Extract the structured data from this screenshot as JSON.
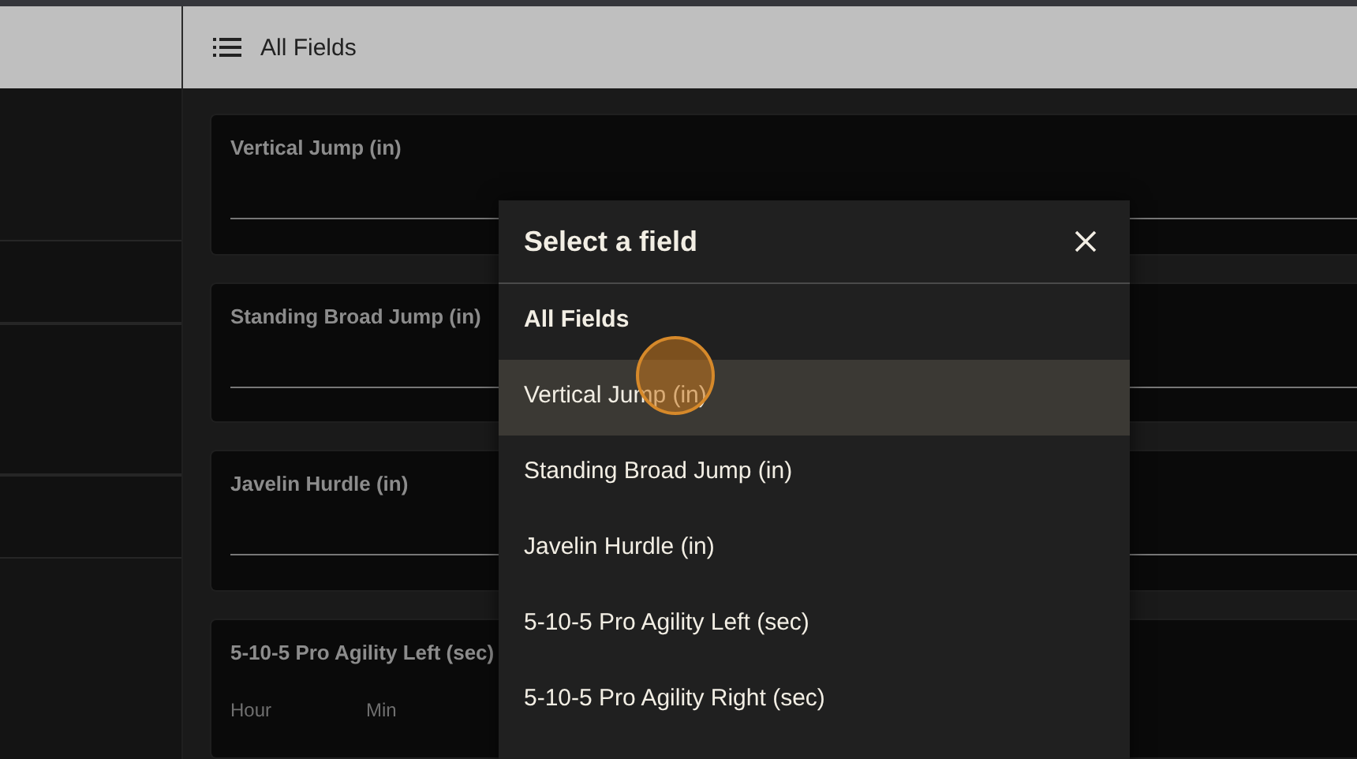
{
  "header": {
    "title": "All Fields"
  },
  "cards": [
    {
      "label": "Vertical Jump (in)",
      "kind": "number"
    },
    {
      "label": "Standing Broad Jump (in)",
      "kind": "number"
    },
    {
      "label": "Javelin Hurdle (in)",
      "kind": "number"
    },
    {
      "label": "5-10-5 Pro Agility Left (sec)",
      "kind": "time",
      "parts": [
        "Hour",
        "Min"
      ]
    }
  ],
  "dialog": {
    "title": "Select a field",
    "items": [
      {
        "label": "All Fields",
        "selected": true,
        "pressed": false
      },
      {
        "label": "Vertical Jump (in)",
        "selected": false,
        "pressed": true
      },
      {
        "label": "Standing Broad Jump (in)",
        "selected": false,
        "pressed": false
      },
      {
        "label": "Javelin Hurdle (in)",
        "selected": false,
        "pressed": false
      },
      {
        "label": "5-10-5 Pro Agility Left (sec)",
        "selected": false,
        "pressed": false
      },
      {
        "label": "5-10-5 Pro Agility Right (sec)",
        "selected": false,
        "pressed": false
      }
    ]
  }
}
